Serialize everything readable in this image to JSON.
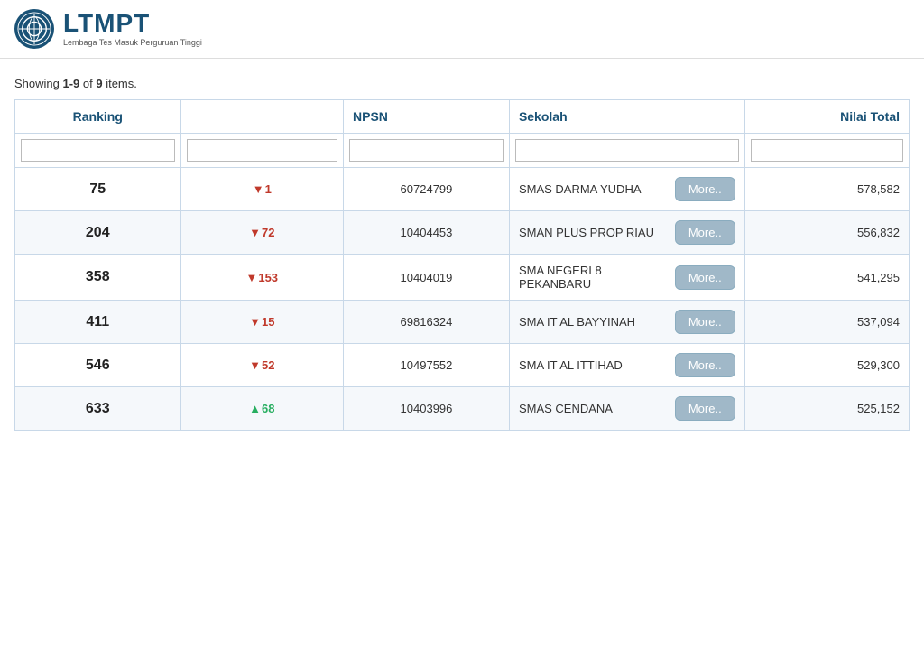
{
  "header": {
    "logo_alt": "LTMPT Logo",
    "brand_name": "LTMPT",
    "brand_subtitle": "Lembaga Tes Masuk Perguruan Tinggi"
  },
  "table": {
    "showing_label": "Showing ",
    "showing_range": "1-9",
    "showing_of": " of ",
    "showing_total": "9",
    "showing_suffix": " items.",
    "columns": {
      "ranking": "Ranking",
      "col2": "",
      "npsn": "NPSN",
      "sekolah": "Sekolah",
      "nilai_total": "Nilai Total"
    },
    "rows": [
      {
        "rank": "75",
        "change_dir": "down",
        "change_val": "1",
        "npsn": "60724799",
        "school": "SMAS DARMA YUDHA",
        "more_label": "More..",
        "nilai": "578,582"
      },
      {
        "rank": "204",
        "change_dir": "down",
        "change_val": "72",
        "npsn": "10404453",
        "school": "SMAN PLUS PROP RIAU",
        "more_label": "More..",
        "nilai": "556,832"
      },
      {
        "rank": "358",
        "change_dir": "down",
        "change_val": "153",
        "npsn": "10404019",
        "school": "SMA NEGERI 8 PEKANBARU",
        "more_label": "More..",
        "nilai": "541,295"
      },
      {
        "rank": "411",
        "change_dir": "down",
        "change_val": "15",
        "npsn": "69816324",
        "school": "SMA IT AL BAYYINAH",
        "more_label": "More..",
        "nilai": "537,094"
      },
      {
        "rank": "546",
        "change_dir": "down",
        "change_val": "52",
        "npsn": "10497552",
        "school": "SMA IT AL ITTIHAD",
        "more_label": "More..",
        "nilai": "529,300"
      },
      {
        "rank": "633",
        "change_dir": "up",
        "change_val": "68",
        "npsn": "10403996",
        "school": "SMAS CENDANA",
        "more_label": "More..",
        "nilai": "525,152"
      }
    ]
  }
}
